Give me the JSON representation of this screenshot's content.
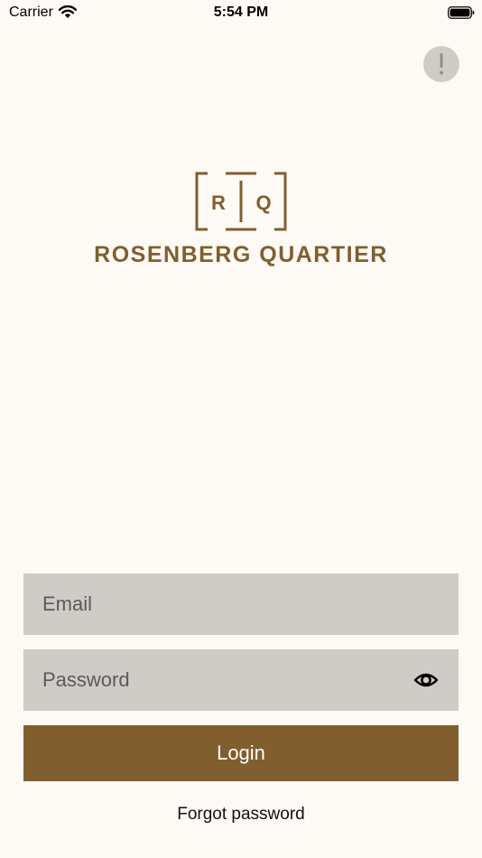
{
  "status_bar": {
    "carrier": "Carrier",
    "time": "5:54 PM",
    "icons": [
      "wifi-icon",
      "battery-icon"
    ]
  },
  "alert": {
    "icon": "exclamation-icon",
    "glyph": "!"
  },
  "logo": {
    "letter_left": "R",
    "letter_right": "Q",
    "name": "ROSENBERG QUARTIER"
  },
  "form": {
    "email_placeholder": "Email",
    "email_value": "",
    "password_placeholder": "Password",
    "password_value": "",
    "password_toggle_icon": "eye-icon",
    "login_label": "Login",
    "forgot_label": "Forgot password"
  },
  "colors": {
    "background": "#fdf9f4",
    "brand": "#805e2e",
    "field": "#cfcbc6"
  }
}
